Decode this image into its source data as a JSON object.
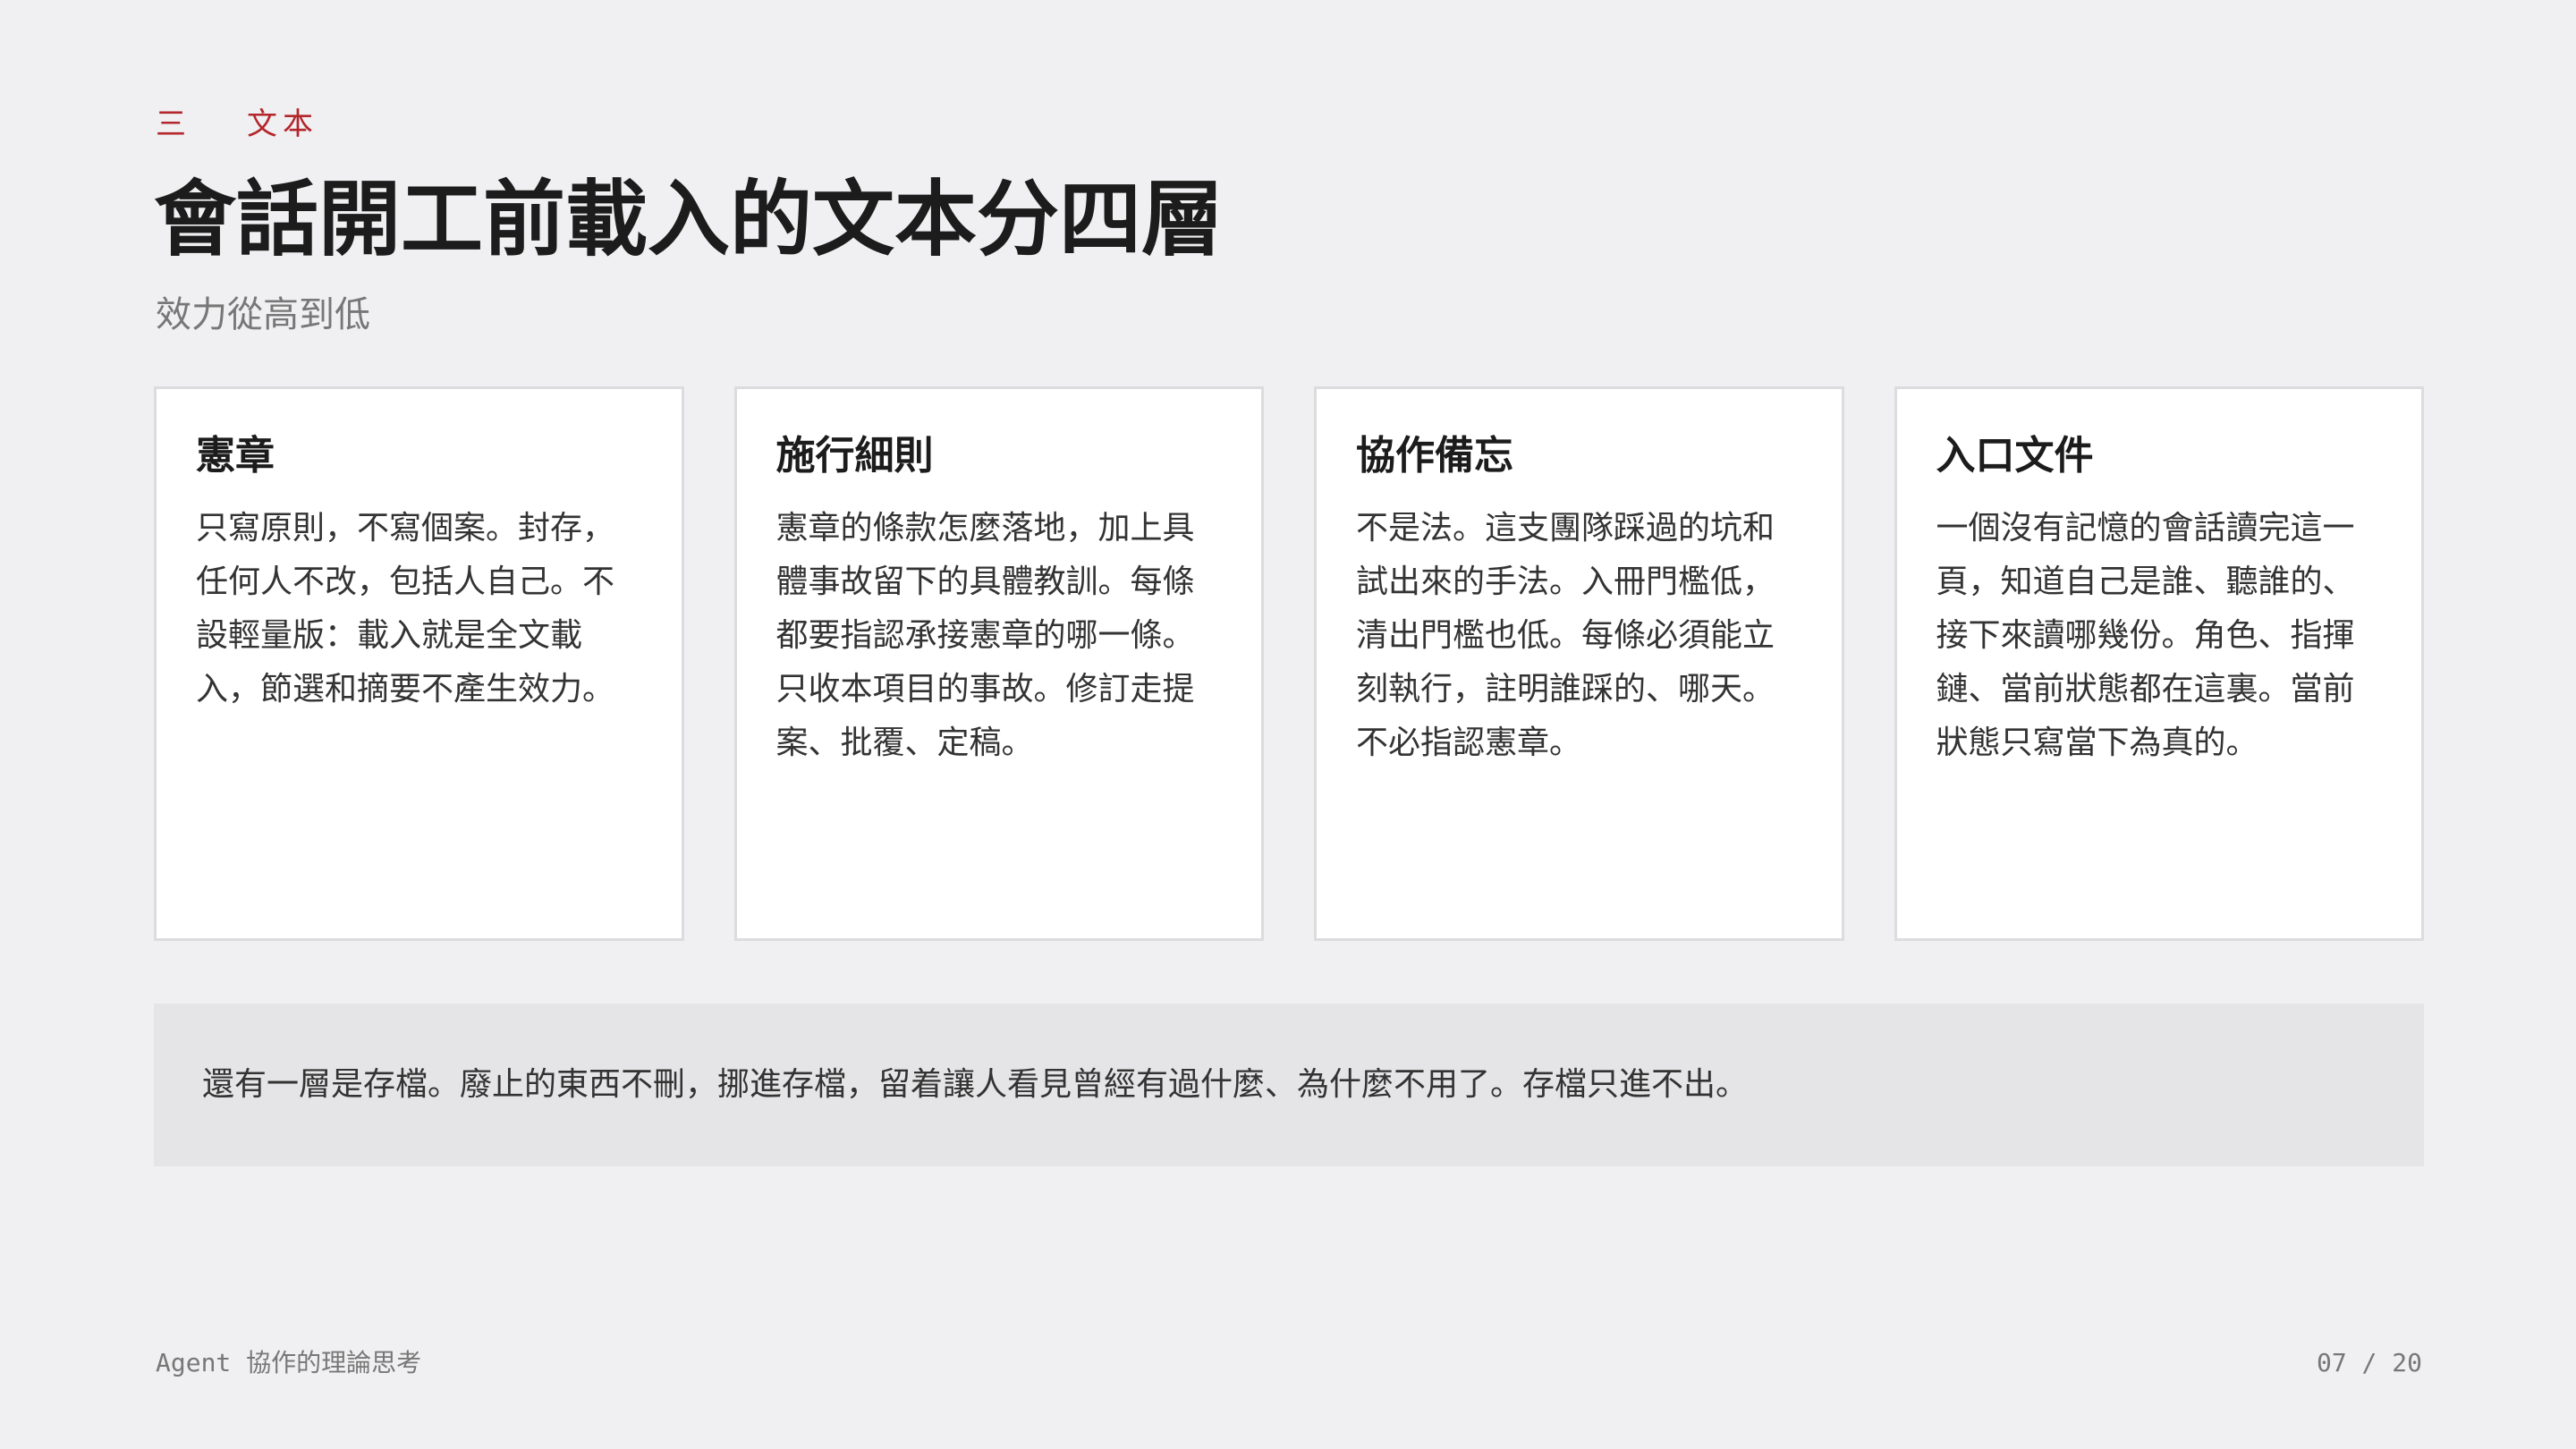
{
  "header": {
    "section_number": "三",
    "section_name": "文本",
    "title": "會話開工前載入的文本分四層",
    "subtitle": "效力從高到低"
  },
  "cards": [
    {
      "title": "憲章",
      "body": "只寫原則，不寫個案。封存，任何人不改，包括人自己。不設輕量版：載入就是全文載入，節選和摘要不產生效力。"
    },
    {
      "title": "施行細則",
      "body": "憲章的條款怎麼落地，加上具體事故留下的具體教訓。每條都要指認承接憲章的哪一條。只收本項目的事故。修訂走提案、批覆、定稿。"
    },
    {
      "title": "協作備忘",
      "body": "不是法。這支團隊踩過的坑和試出來的手法。入冊門檻低，清出門檻也低。每條必須能立刻執行，註明誰踩的、哪天。不必指認憲章。"
    },
    {
      "title": "入口文件",
      "body": "一個沒有記憶的會話讀完這一頁，知道自己是誰、聽誰的、接下來讀哪幾份。角色、指揮鏈、當前狀態都在這裏。當前狀態只寫當下為真的。"
    }
  ],
  "note": "還有一層是存檔。廢止的東西不刪，挪進存檔，留着讓人看見曾經有過什麼、為什麼不用了。存檔只進不出。",
  "footer": {
    "deck_title": "Agent 協作的理論思考",
    "page_indicator": "07 / 20"
  },
  "colors": {
    "accent": "#b3262b",
    "background": "#f0f0f2",
    "card_background": "#ffffff",
    "note_background": "#e5e5e7"
  }
}
